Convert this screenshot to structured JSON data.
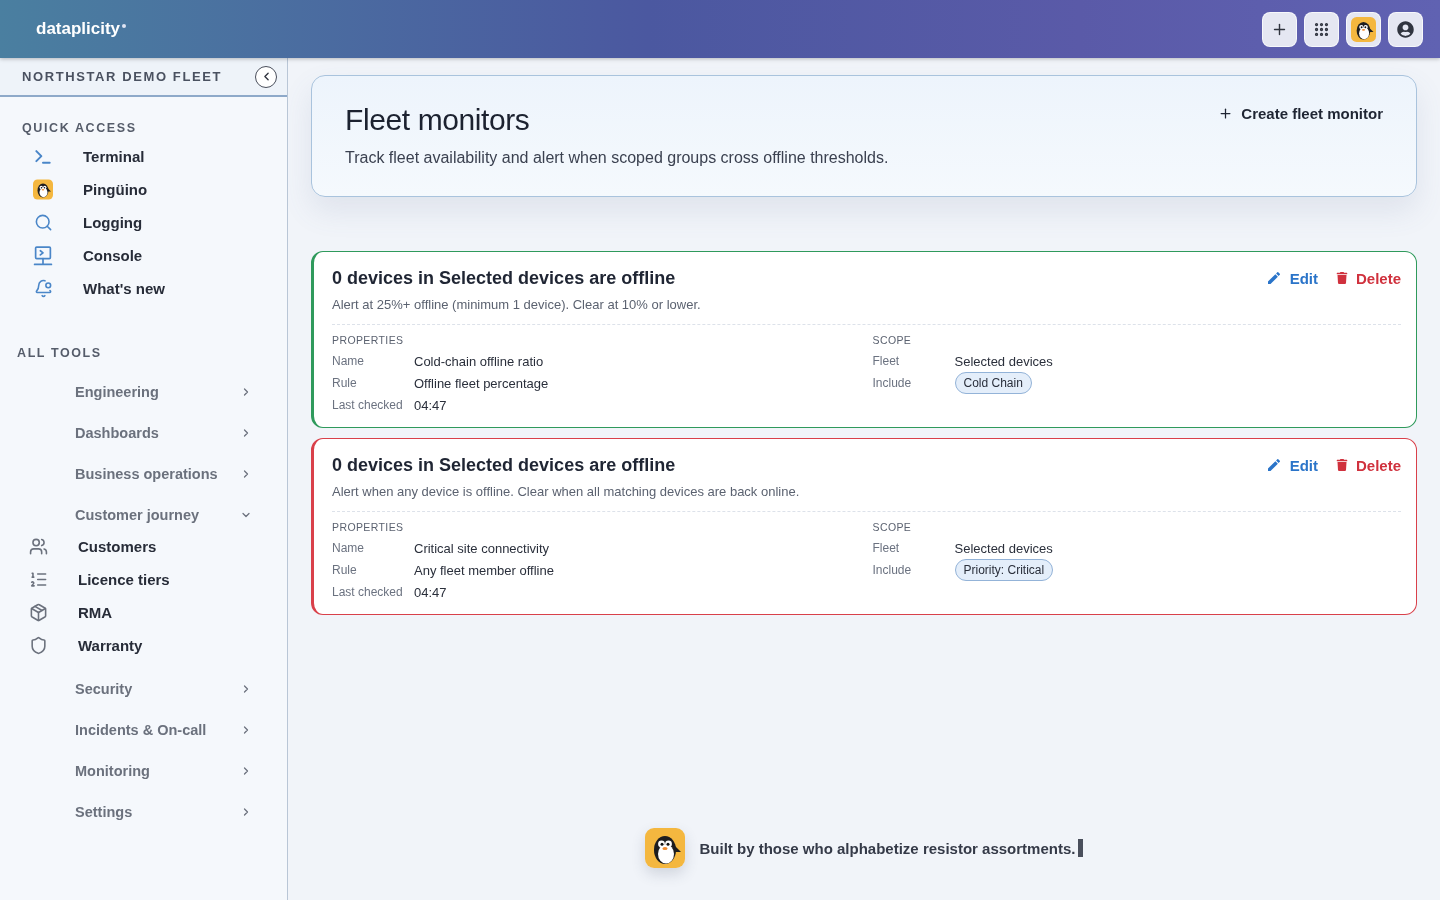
{
  "topbar": {
    "brand": "dataplicity"
  },
  "sidebar": {
    "fleet_name": "NORTHSTAR DEMO FLEET",
    "quick_access": {
      "heading": "QUICK ACCESS",
      "items": [
        {
          "label": "Terminal"
        },
        {
          "label": "Pingüino"
        },
        {
          "label": "Logging"
        },
        {
          "label": "Console"
        },
        {
          "label": "What's new"
        }
      ]
    },
    "all_tools": {
      "heading": "ALL TOOLS",
      "groups": [
        {
          "label": "Engineering",
          "expanded": false
        },
        {
          "label": "Dashboards",
          "expanded": false
        },
        {
          "label": "Business operations",
          "expanded": false
        },
        {
          "label": "Customer journey",
          "expanded": true,
          "children": [
            {
              "label": "Customers"
            },
            {
              "label": "Licence tiers"
            },
            {
              "label": "RMA"
            },
            {
              "label": "Warranty"
            }
          ]
        },
        {
          "label": "Security",
          "expanded": false
        },
        {
          "label": "Incidents & On-call",
          "expanded": false
        },
        {
          "label": "Monitoring",
          "expanded": false
        },
        {
          "label": "Settings",
          "expanded": false
        }
      ]
    }
  },
  "header": {
    "title": "Fleet monitors",
    "subtitle": "Track fleet availability and alert when scoped groups cross offline thresholds.",
    "create_button": "Create fleet monitor"
  },
  "monitors": [
    {
      "color": "#2f9a5c",
      "title": "0 devices in Selected devices are offline",
      "description": "Alert at 25%+ offline (minimum 1 device). Clear at 10% or lower.",
      "edit": "Edit",
      "delete": "Delete",
      "properties": {
        "heading": "PROPERTIES",
        "rows": [
          {
            "label": "Name",
            "value": "Cold-chain offline ratio"
          },
          {
            "label": "Rule",
            "value": "Offline fleet percentage"
          },
          {
            "label": "Last checked",
            "value": "04:47"
          }
        ]
      },
      "scope": {
        "heading": "SCOPE",
        "rows": [
          {
            "kind": "text",
            "label": "Fleet",
            "value": "Selected devices"
          },
          {
            "kind": "tag",
            "label": "Include",
            "value": "Cold Chain"
          }
        ]
      }
    },
    {
      "color": "#d9404a",
      "title": "0 devices in Selected devices are offline",
      "description": "Alert when any device is offline. Clear when all matching devices are back online.",
      "edit": "Edit",
      "delete": "Delete",
      "properties": {
        "heading": "PROPERTIES",
        "rows": [
          {
            "label": "Name",
            "value": "Critical site connectivity"
          },
          {
            "label": "Rule",
            "value": "Any fleet member offline"
          },
          {
            "label": "Last checked",
            "value": "04:47"
          }
        ]
      },
      "scope": {
        "heading": "SCOPE",
        "rows": [
          {
            "kind": "text",
            "label": "Fleet",
            "value": "Selected devices"
          },
          {
            "kind": "tag",
            "label": "Include",
            "value": "Priority: Critical"
          }
        ]
      }
    }
  ],
  "footer": {
    "text": "Built by those who alphabetize resistor assortments."
  }
}
